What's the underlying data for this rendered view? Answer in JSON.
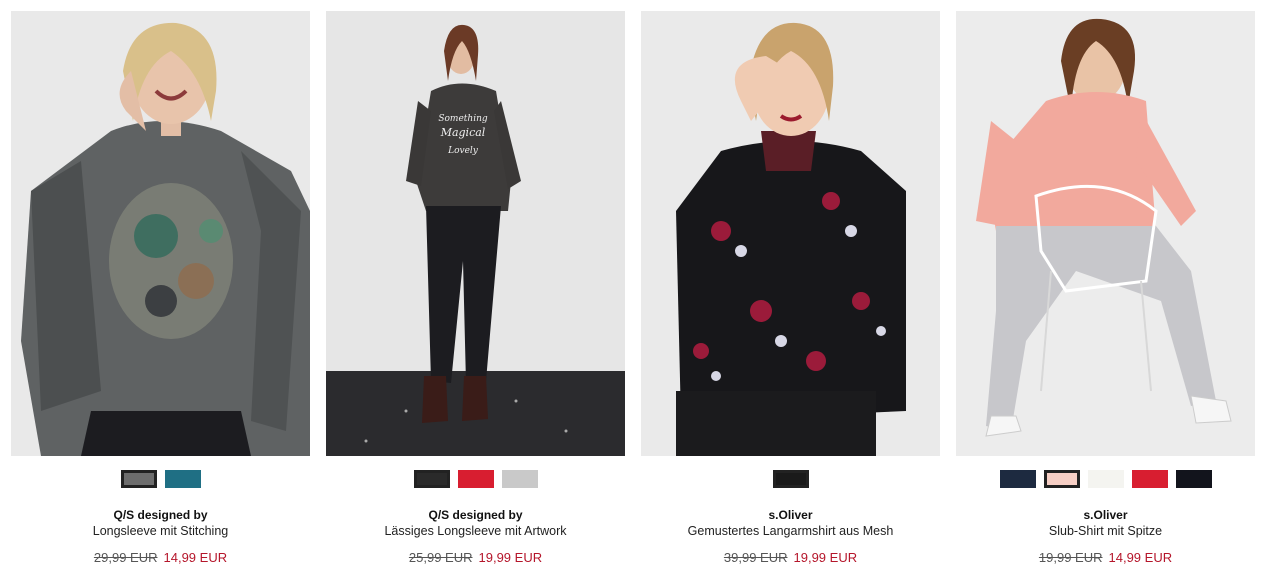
{
  "products": [
    {
      "brand": "Q/S designed by",
      "name": "Longsleeve mit Stitching",
      "old_price": "29,99 EUR",
      "new_price": "14,99 EUR",
      "swatches": [
        "#6d6d6d",
        "#1f6f84"
      ]
    },
    {
      "brand": "Q/S designed by",
      "name": "Lässiges Longsleeve mit Artwork",
      "old_price": "25,99 EUR",
      "new_price": "19,99 EUR",
      "swatches": [
        "#2a2a2a",
        "#d81e30",
        "#c9c9c9"
      ]
    },
    {
      "brand": "s.Oliver",
      "name": "Gemustertes Langarmshirt aus Mesh",
      "old_price": "39,99 EUR",
      "new_price": "19,99 EUR",
      "swatches": [
        "#1a1a1a"
      ]
    },
    {
      "brand": "s.Oliver",
      "name": "Slub-Shirt mit Spitze",
      "old_price": "19,99 EUR",
      "new_price": "14,99 EUR",
      "swatches": [
        "#1d2a40",
        "#f7cfc5",
        "#f4f4f0",
        "#d81e30",
        "#12141c"
      ]
    }
  ],
  "colors": {
    "sale_price": "#b5162b",
    "old_price": "#555555"
  }
}
